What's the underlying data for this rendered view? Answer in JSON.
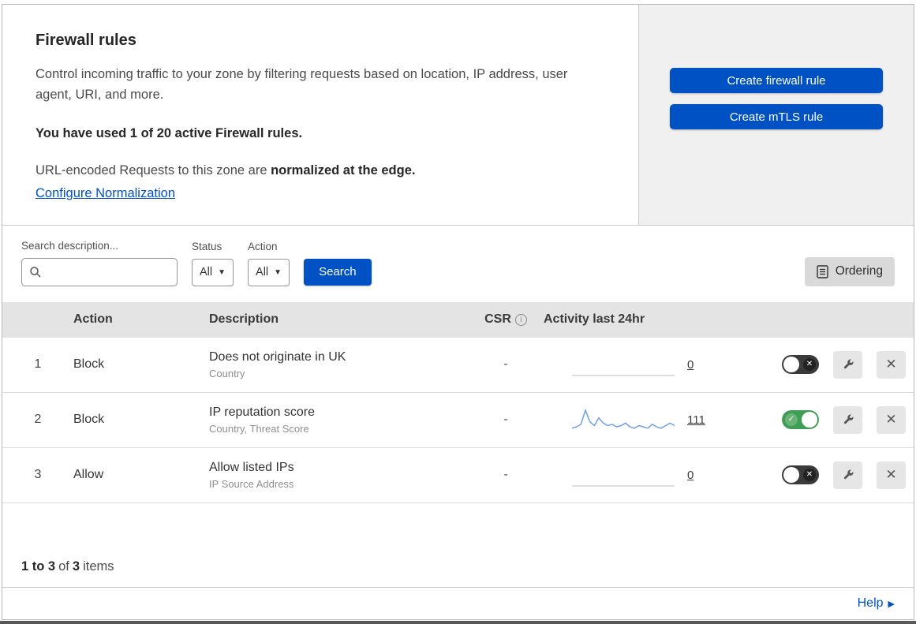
{
  "colors": {
    "accent": "#0051c3",
    "link": "#0051c3",
    "toggle_on": "#3f9e54",
    "toggle_off": "#3a3a3a",
    "sparkline": "#6d9fe8",
    "flatline": "#cfd4da",
    "header_bg": "#e4e4e4",
    "panel_bg": "#f0f0f0"
  },
  "header": {
    "title": "Firewall rules",
    "description": "Control incoming traffic to your zone by filtering requests based on location, IP address, user agent, URI, and more.",
    "usage": "You have used 1 of 20 active Firewall rules.",
    "normalization_prefix": "URL-encoded Requests to this zone are ",
    "normalization_bold": "normalized at the edge.",
    "normalization_link": "Configure Normalization",
    "create_firewall_button": "Create firewall rule",
    "create_mtls_button": "Create mTLS rule"
  },
  "filters": {
    "search_label": "Search description...",
    "status_label": "Status",
    "status_value": "All",
    "action_label": "Action",
    "action_value": "All",
    "search_button": "Search",
    "ordering_button": "Ordering"
  },
  "table": {
    "headers": {
      "action": "Action",
      "description": "Description",
      "csr": "CSR",
      "activity": "Activity last 24hr"
    },
    "rows": [
      {
        "index": "1",
        "action": "Block",
        "description": "Does not originate in UK",
        "subtitle": "Country",
        "csr": "-",
        "activity_count": "0",
        "enabled": false,
        "sparkline": [
          0,
          0,
          0,
          0,
          0,
          0,
          0,
          0,
          0,
          0,
          0,
          0,
          0,
          0,
          0,
          0,
          0,
          0,
          0,
          0,
          0,
          0,
          0,
          0
        ]
      },
      {
        "index": "2",
        "action": "Block",
        "description": "IP reputation score",
        "subtitle": "Country, Threat Score",
        "csr": "-",
        "activity_count": "111",
        "enabled": true,
        "sparkline": [
          2,
          3,
          5,
          16,
          7,
          4,
          10,
          6,
          4,
          5,
          3,
          4,
          6,
          3,
          2,
          4,
          3,
          2,
          5,
          3,
          2,
          4,
          6,
          4
        ]
      },
      {
        "index": "3",
        "action": "Allow",
        "description": "Allow listed IPs",
        "subtitle": "IP Source Address",
        "csr": "-",
        "activity_count": "0",
        "enabled": false,
        "sparkline": [
          0,
          0,
          0,
          0,
          0,
          0,
          0,
          0,
          0,
          0,
          0,
          0,
          0,
          0,
          0,
          0,
          0,
          0,
          0,
          0,
          0,
          0,
          0,
          0
        ]
      }
    ]
  },
  "footer": {
    "range": "1 to 3",
    "of_text": "of",
    "total": "3",
    "items_text": "items"
  },
  "help": {
    "label": "Help",
    "arrow": "▶"
  }
}
